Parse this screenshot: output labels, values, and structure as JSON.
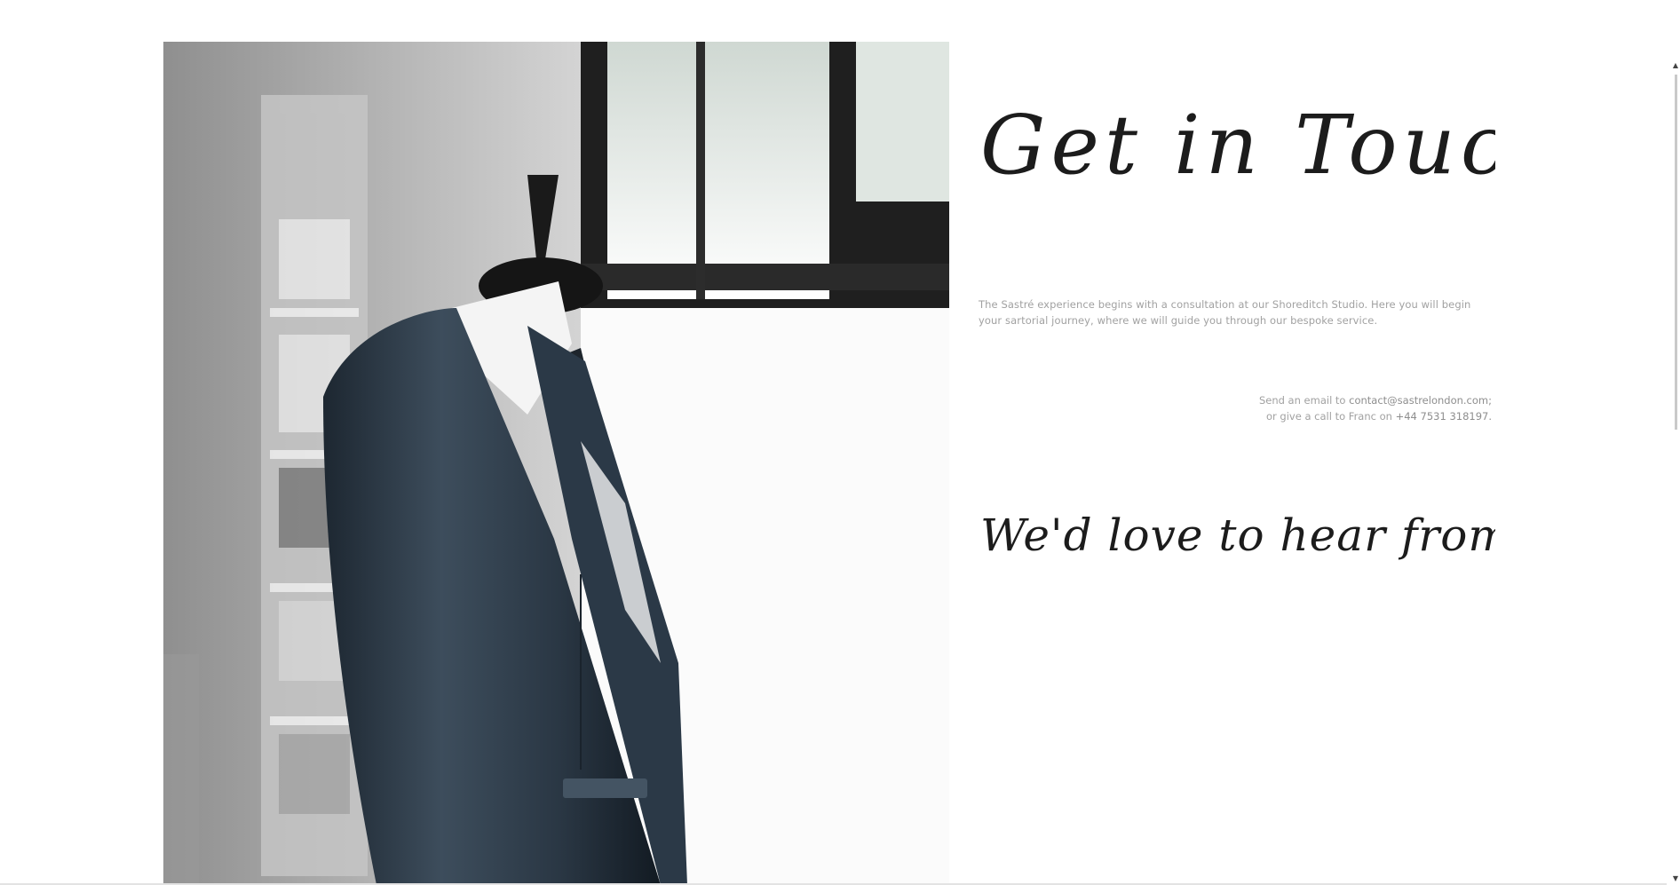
{
  "page": {
    "heading": "Get in Touch",
    "intro": "The Sastré experience begins with a consultation at our Shoreditch Studio. Here you will begin your sartorial journey, where we will guide you through our bespoke service.",
    "contact": {
      "email_prefix": "Send an email to ",
      "email": "contact@sastrelondon.com;",
      "phone_prefix": "or give a call to Franc on ",
      "phone": "+44 7531 318197."
    },
    "tagline": "We'd love to hear from you!"
  },
  "colors": {
    "text": "#a1a1a1",
    "script": "#1c1c1c",
    "suit": "#33414f"
  },
  "icons": {
    "scroll_up": "triangle-up-icon",
    "scroll_down": "triangle-down-icon"
  }
}
